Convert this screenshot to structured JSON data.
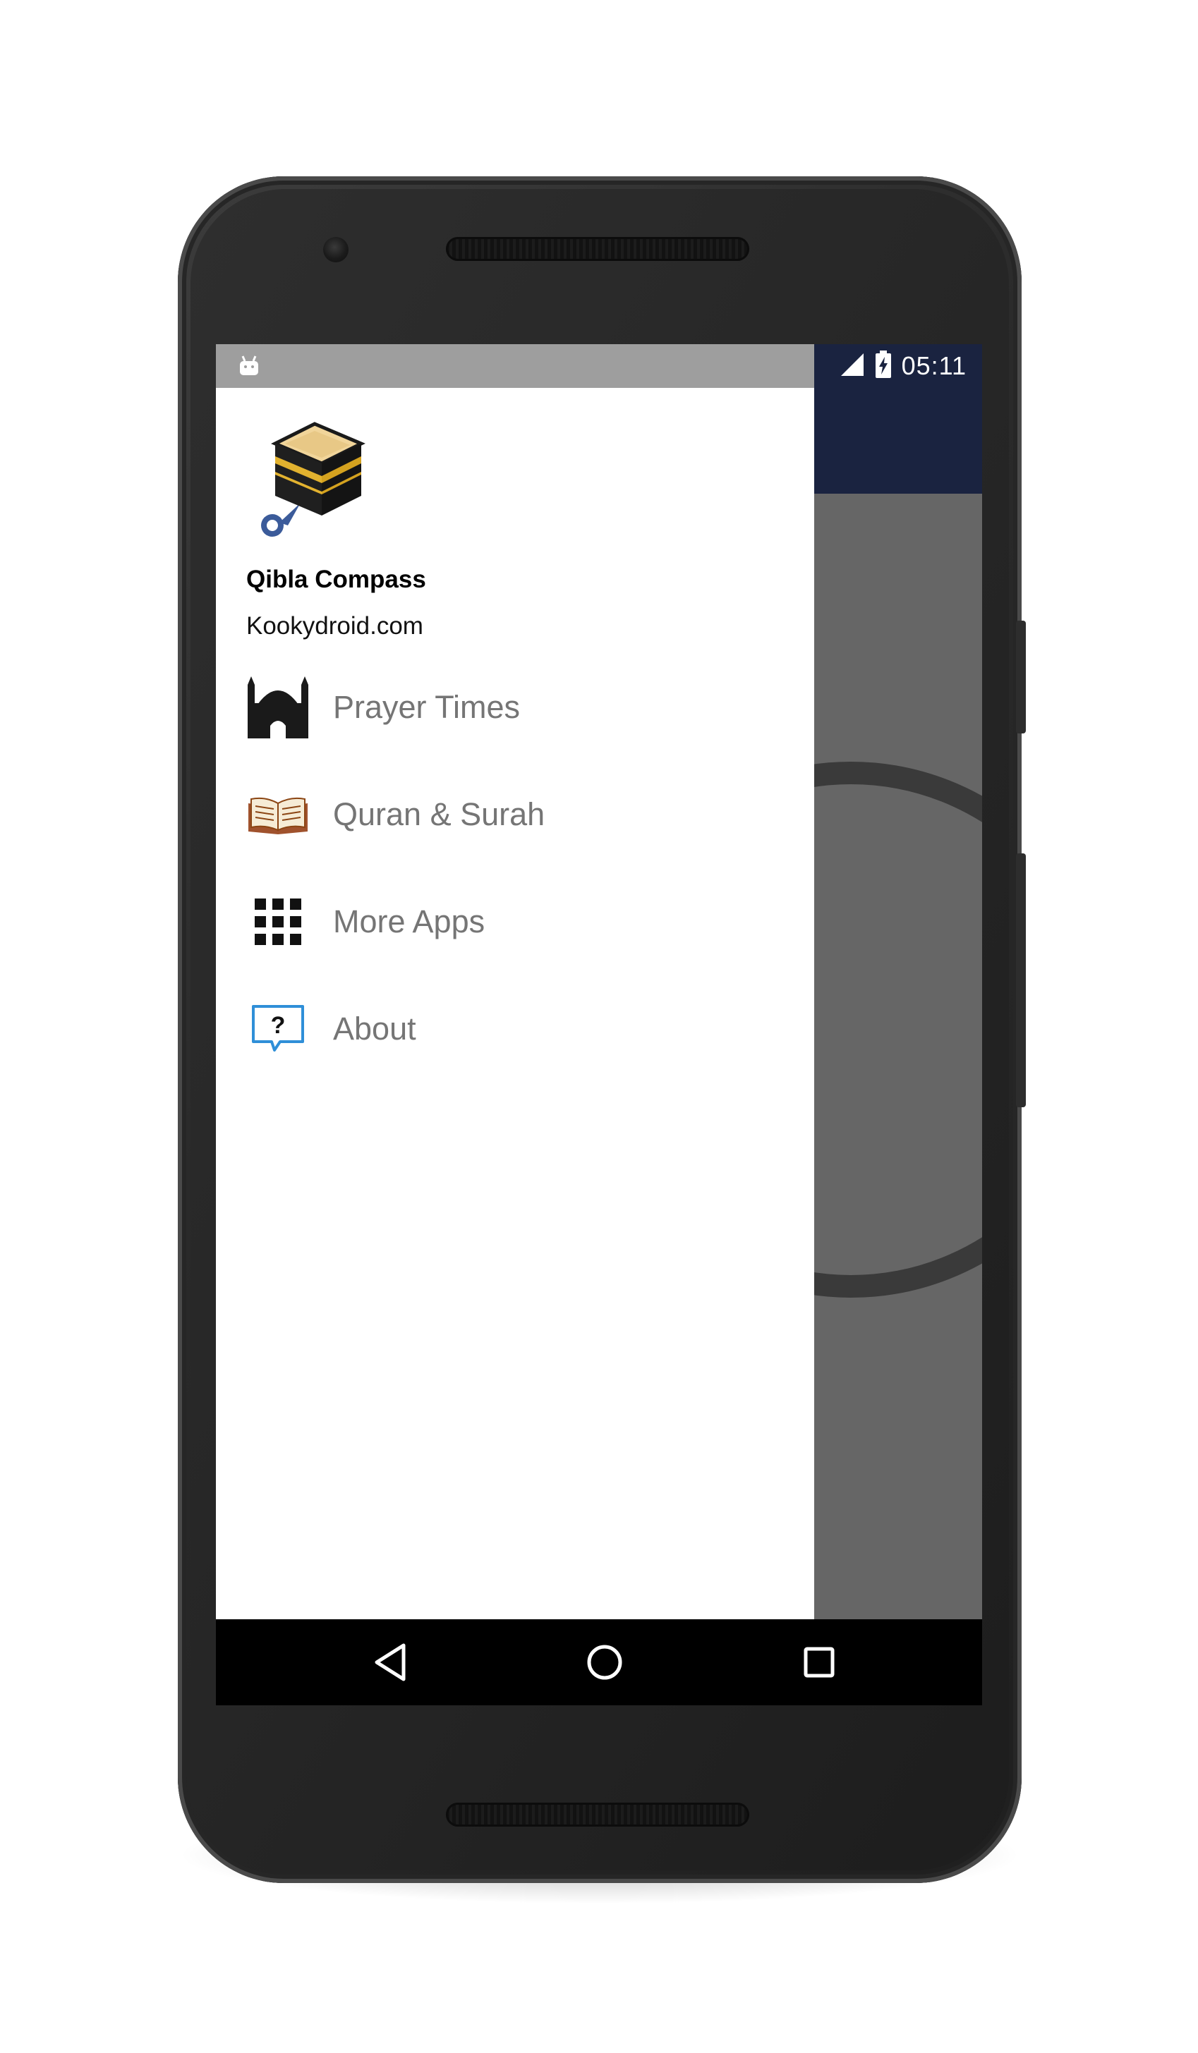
{
  "status_bar": {
    "time": "05:11",
    "icons": [
      "android-debug-icon",
      "signal-icon",
      "battery-charging-icon"
    ]
  },
  "drawer": {
    "header": {
      "app_name": "Qibla Compass",
      "website": "Kookydroid.com",
      "logo": "kaaba-compass-logo"
    },
    "menu_items": [
      {
        "label": "Prayer Times",
        "icon": "mosque-icon"
      },
      {
        "label": "Quran & Surah",
        "icon": "quran-book-icon"
      },
      {
        "label": "More Apps",
        "icon": "grid-apps-icon"
      },
      {
        "label": "About",
        "icon": "question-bubble-icon"
      }
    ]
  },
  "nav_bar": {
    "buttons": [
      "back-icon",
      "home-icon",
      "recents-icon"
    ]
  },
  "colors": {
    "app_bar": "#1a2340",
    "scrim": "#666666",
    "menu_text": "#757575",
    "status_bar_drawer": "#9e9e9e"
  }
}
